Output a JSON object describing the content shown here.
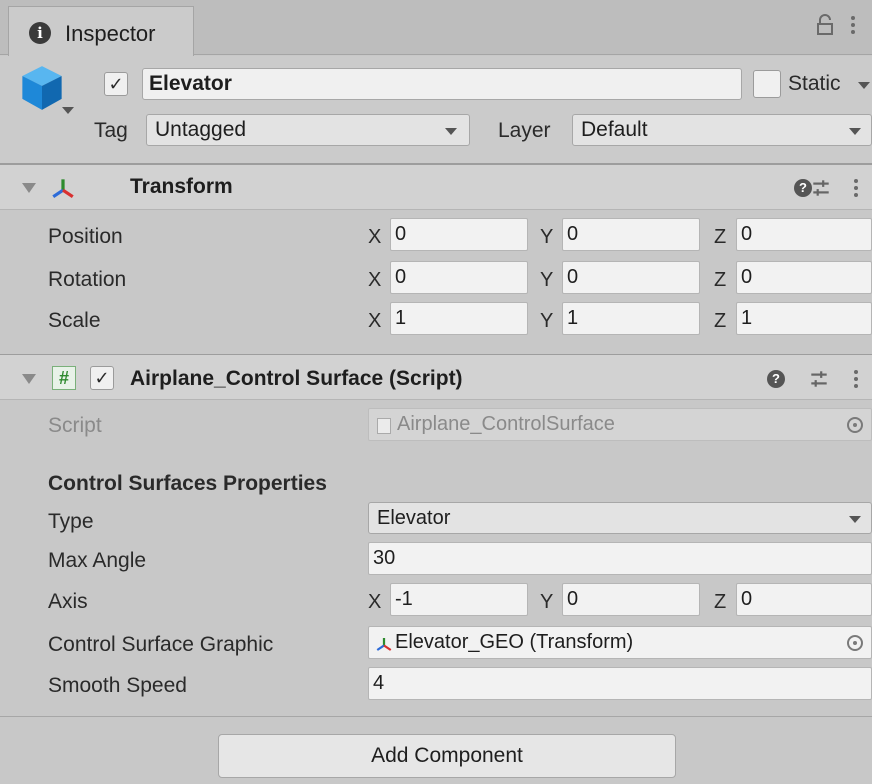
{
  "tab": {
    "icon": "info-icon",
    "title": "Inspector"
  },
  "header": {
    "object_icon": "cube-icon",
    "active": true,
    "name": "Elevator",
    "static_label": "Static",
    "tag_label": "Tag",
    "tag_value": "Untagged",
    "layer_label": "Layer",
    "layer_value": "Default"
  },
  "transform": {
    "title": "Transform",
    "rows": [
      {
        "label": "Position",
        "x": "0",
        "y": "0",
        "z": "0"
      },
      {
        "label": "Rotation",
        "x": "0",
        "y": "0",
        "z": "0"
      },
      {
        "label": "Scale",
        "x": "1",
        "y": "1",
        "z": "1"
      }
    ]
  },
  "axis_labels": {
    "x": "X",
    "y": "Y",
    "z": "Z"
  },
  "script_component": {
    "title": "Airplane_Control Surface (Script)",
    "enabled": true,
    "script_label": "Script",
    "script_value": "Airplane_ControlSurface",
    "section_header": "Control Surfaces Properties",
    "type_label": "Type",
    "type_value": "Elevator",
    "max_angle_label": "Max Angle",
    "max_angle_value": "30",
    "axis_label": "Axis",
    "axis_x": "-1",
    "axis_y": "0",
    "axis_z": "0",
    "graphic_label": "Control Surface Graphic",
    "graphic_value": "Elevator_GEO (Transform)",
    "smooth_label": "Smooth Speed",
    "smooth_value": "4"
  },
  "add_component_label": "Add Component",
  "colors": {
    "panel": "#c8c8c8",
    "field": "#f2f2f2",
    "cube": "#1e88d8"
  }
}
